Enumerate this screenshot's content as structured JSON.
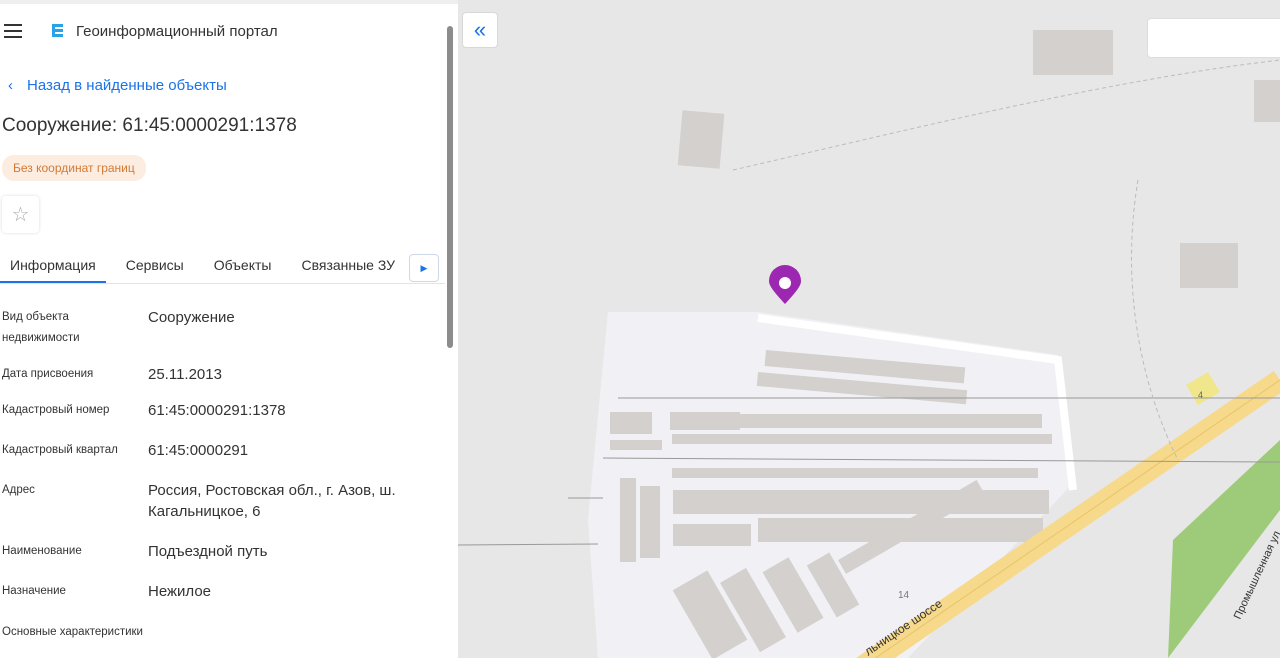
{
  "header": {
    "app_title": "Геоинформационный портал",
    "menu_icon": "hamburger-icon",
    "logo_icon": "portal-logo-icon"
  },
  "back_link": "Назад в найденные объекты",
  "object_title": "Сооружение: 61:45:0000291:1378",
  "status_badge": "Без координат границ",
  "status_badge_color": "#d27a36",
  "tabs": [
    {
      "label": "Информация",
      "active": true
    },
    {
      "label": "Сервисы"
    },
    {
      "label": "Объекты"
    },
    {
      "label": "Связанные ЗУ"
    }
  ],
  "fields": [
    {
      "label": "Вид объекта недвижимости",
      "value": "Сооружение"
    },
    {
      "label": "Дата присвоения",
      "value": "25.11.2013"
    },
    {
      "label": "Кадастровый номер",
      "value": "61:45:0000291:1378"
    },
    {
      "label": "Кадастровый квартал",
      "value": "61:45:0000291"
    },
    {
      "label": "Адрес",
      "value": "Россия, Ростовская обл., г. Азов, ш. Кагальницкое, 6"
    },
    {
      "label": "Наименование",
      "value": "Подъездной путь"
    },
    {
      "label": "Назначение",
      "value": "Нежилое"
    },
    {
      "label": "Основные характеристики",
      "value": ""
    }
  ],
  "map": {
    "road_label": "Кагальницкое шоссе",
    "road_label_visible": "льницкое шоссе",
    "street_label": "Промышленная ул",
    "house_numbers": [
      "4",
      "14"
    ],
    "marker_color": "#9c27b0",
    "road_color": "#f7d98b",
    "park_color": "#9ecb7a"
  }
}
